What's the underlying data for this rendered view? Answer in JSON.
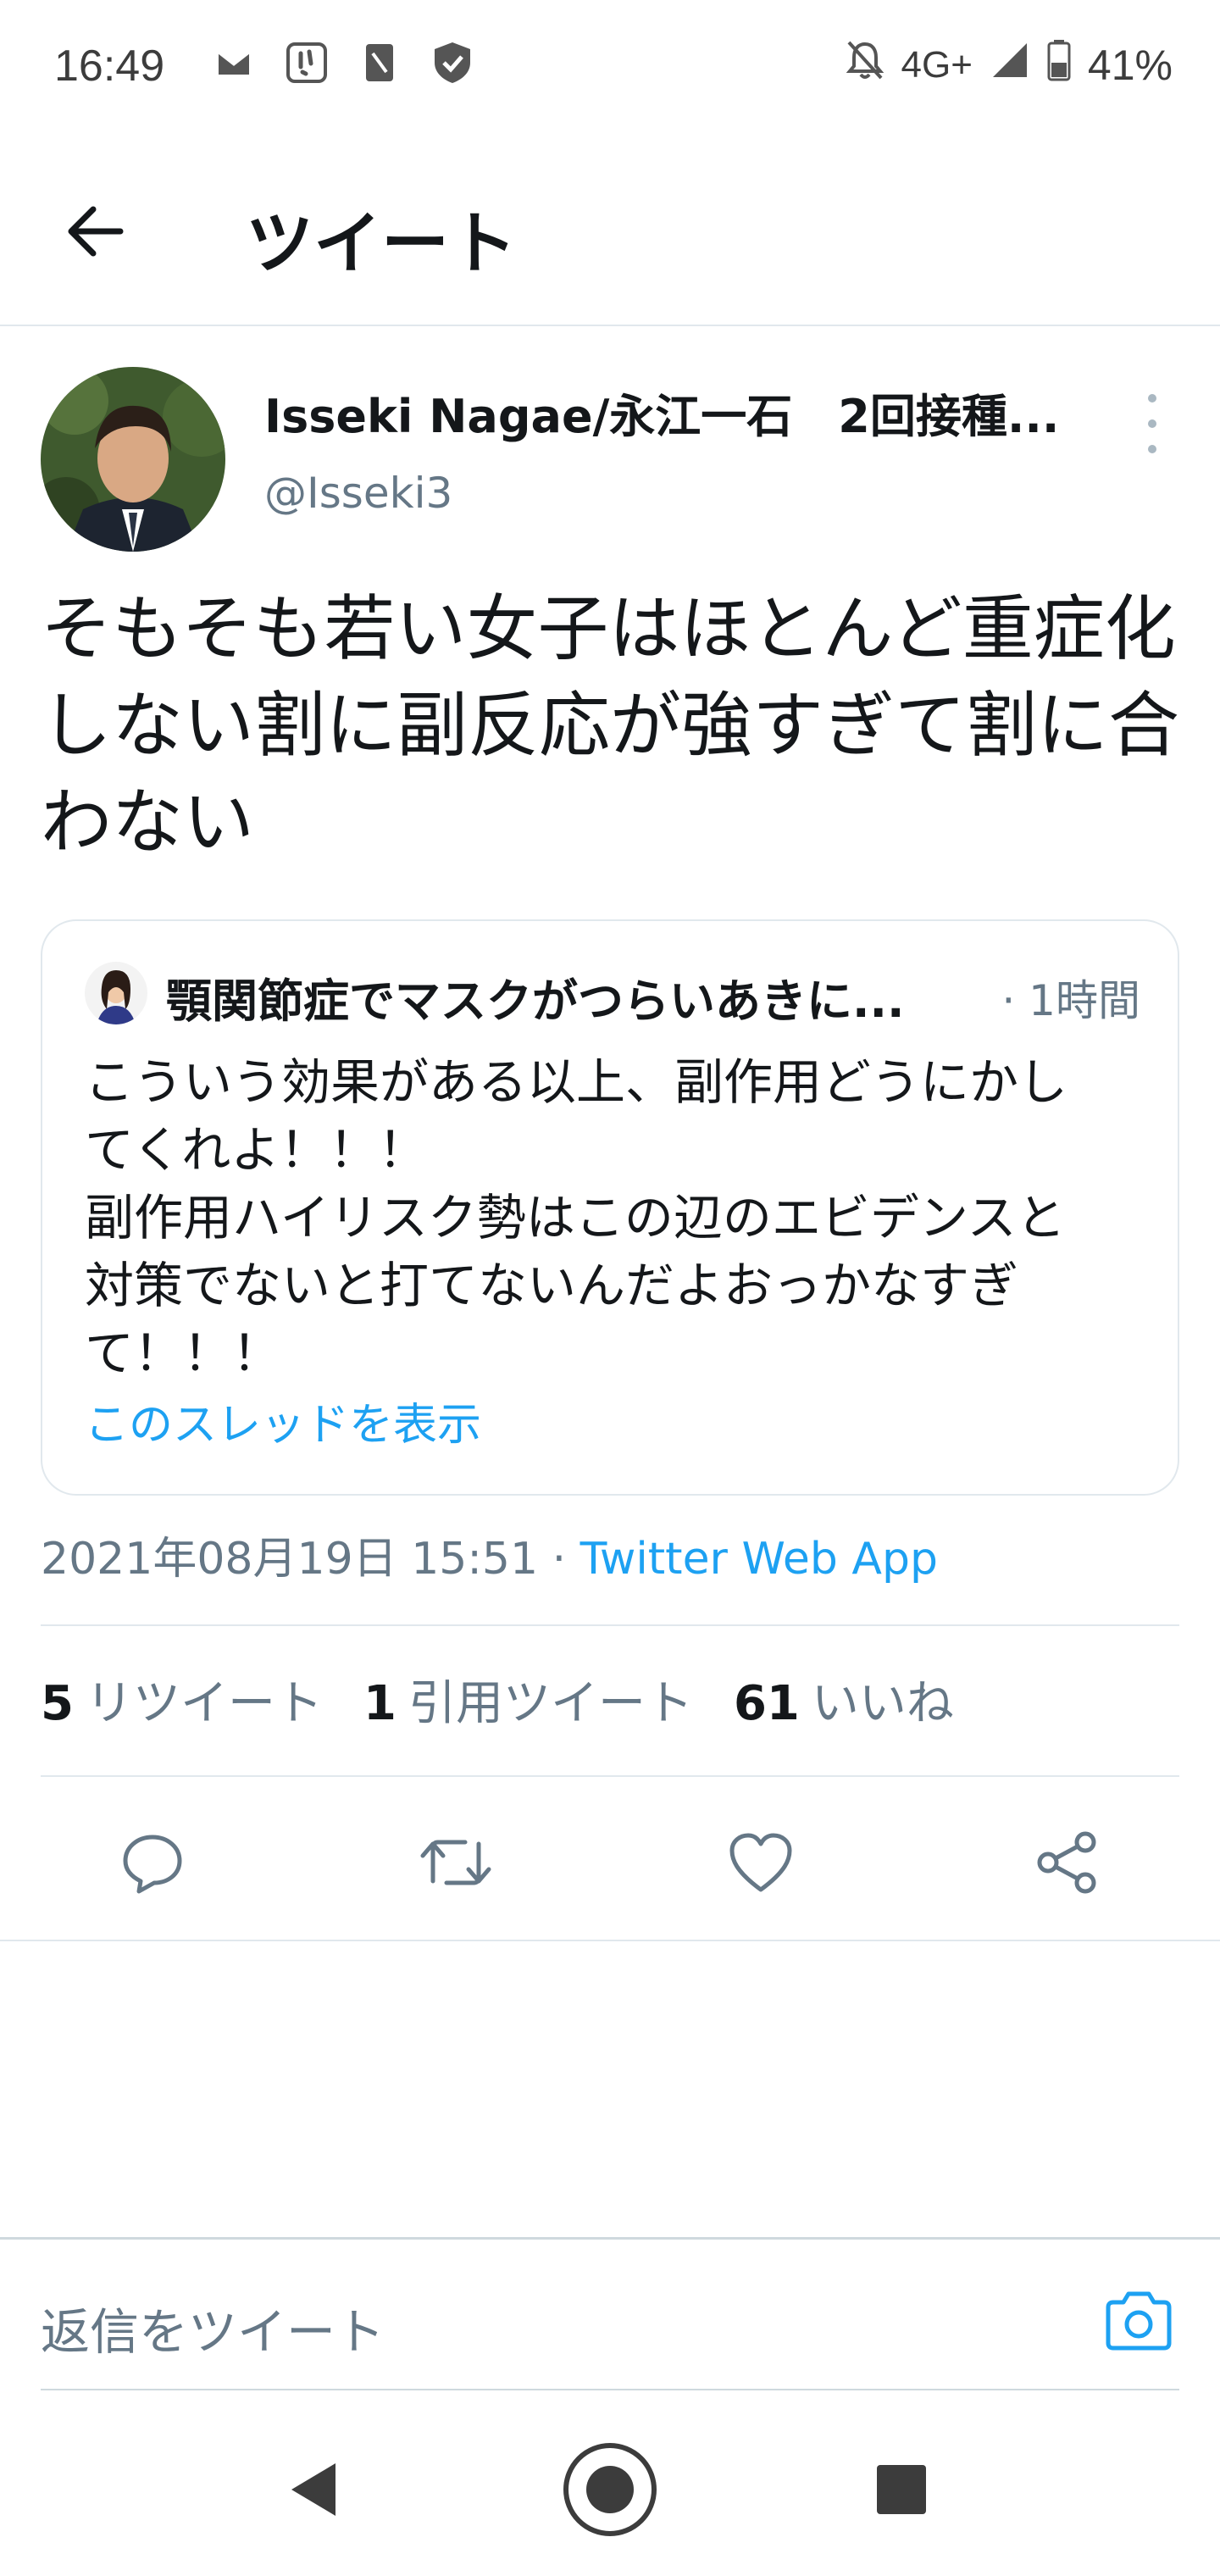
{
  "status_bar": {
    "time": "16:49",
    "network": "4G+",
    "battery": "41%",
    "icons": [
      "mail-icon",
      "app-icon",
      "sim-icon",
      "shield-icon",
      "bell-off-icon",
      "signal-icon",
      "battery-icon"
    ]
  },
  "app_bar": {
    "title": "ツイート",
    "back_icon": "arrow-left-icon"
  },
  "tweet": {
    "author_name": "Isseki Nagae/永江一石　2回接種...",
    "author_handle": "@Isseki3",
    "text": "そもそも若い女子はほとんど重症化しない割に副反応が強すぎて割に合わない",
    "quoted": {
      "author_name": "顎関節症でマスクがつらいあきに...",
      "time": "· 1時間",
      "text_lines": [
        "こういう効果がある以上、副作用どうにかし",
        "てくれよ！！！",
        "副作用ハイリスク勢はこの辺のエビデンスと",
        "対策でないと打てないんだよおっかなすぎ",
        "て！！！"
      ],
      "thread_link": "このスレッドを表示"
    },
    "timestamp": "2021年08月19日 15:51 · ",
    "source": "Twitter Web App",
    "stats": {
      "retweets_count": "5",
      "retweets_label": "リツイート",
      "quotes_count": "1",
      "quotes_label": "引用ツイート",
      "likes_count": "61",
      "likes_label": "いいね"
    },
    "actions": [
      "reply-icon",
      "retweet-icon",
      "like-icon",
      "share-icon"
    ]
  },
  "reply": {
    "placeholder": "返信をツイート"
  },
  "colors": {
    "accent": "#1da1f2",
    "secondary_text": "#657786",
    "divider": "#e1e8ed"
  }
}
